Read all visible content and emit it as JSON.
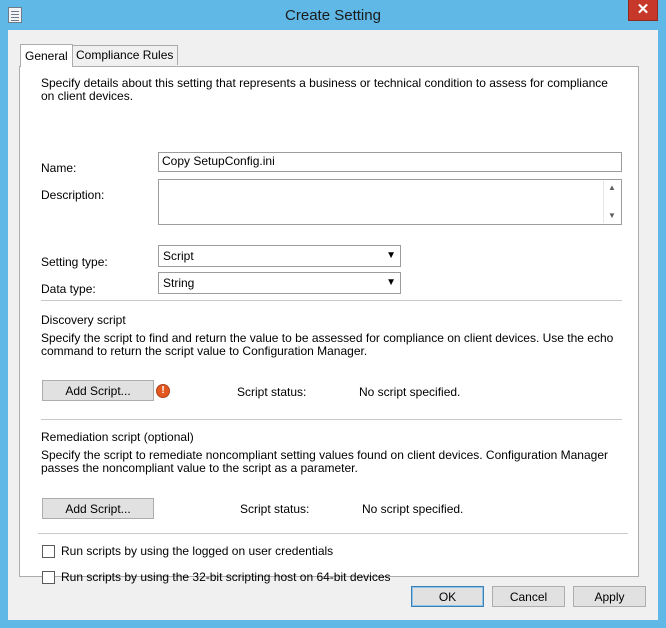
{
  "window": {
    "title": "Create Setting",
    "close_glyph": "✕"
  },
  "tabs": [
    {
      "label": "General",
      "selected": true
    },
    {
      "label": "Compliance Rules",
      "selected": false
    }
  ],
  "general": {
    "intro": "Specify details about this setting that represents a business or technical condition to assess for compliance on client devices.",
    "name_label": "Name:",
    "name_value": "Copy SetupConfig.ini",
    "description_label": "Description:",
    "description_value": "",
    "setting_type_label": "Setting type:",
    "setting_type_value": "Script",
    "data_type_label": "Data type:",
    "data_type_value": "String"
  },
  "discovery": {
    "heading": "Discovery script",
    "text": "Specify the script to find and return the value to be assessed for compliance on client devices. Use the echo command to return the script value to Configuration Manager.",
    "button_label": "Add Script...",
    "status_label": "Script status:",
    "status_value": "No script specified.",
    "error_glyph": "!"
  },
  "remediation": {
    "heading": "Remediation script (optional)",
    "text": "Specify the script to remediate noncompliant setting values found on client devices. Configuration Manager passes the noncompliant value to the script as a parameter.",
    "button_label": "Add Script...",
    "status_label": "Script status:",
    "status_value": "No script specified."
  },
  "options": [
    {
      "label": "Run scripts by using the logged on user credentials",
      "checked": false
    },
    {
      "label": "Run scripts by using the 32-bit scripting host on 64-bit devices",
      "checked": false
    }
  ],
  "footer": {
    "ok": "OK",
    "cancel": "Cancel",
    "apply": "Apply"
  },
  "colors": {
    "title_bar": "#5fb8e6",
    "close_button": "#c7372a",
    "error_icon": "#e2581e"
  }
}
